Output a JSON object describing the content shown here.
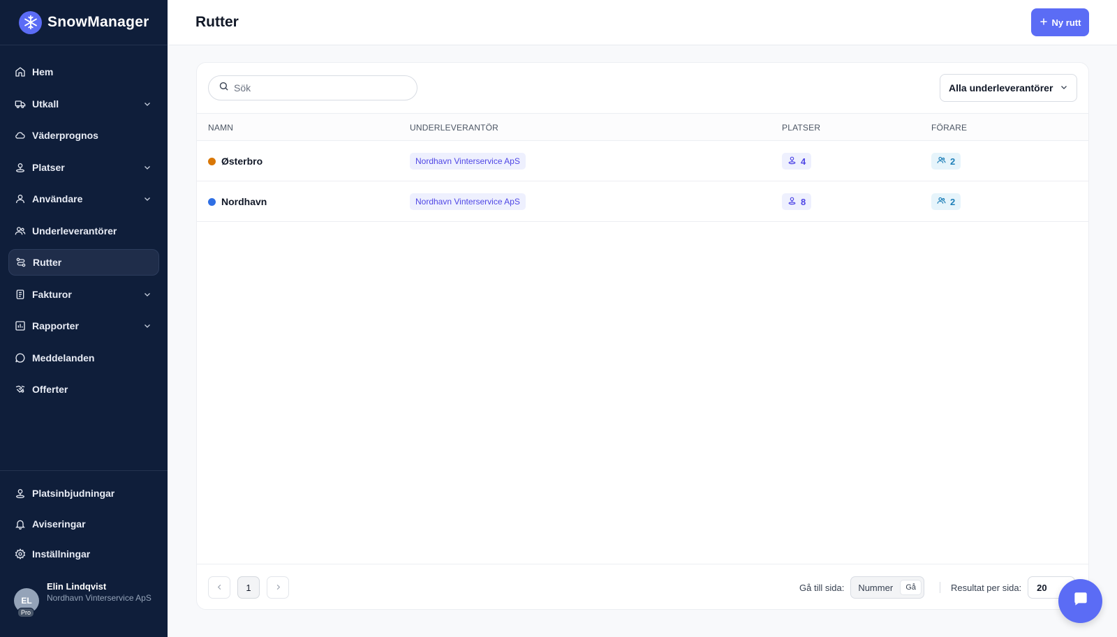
{
  "app": {
    "name": "SnowManager"
  },
  "sidebar": {
    "items": [
      {
        "label": "Hem",
        "icon": "home-icon",
        "expandable": false,
        "active": false
      },
      {
        "label": "Utkall",
        "icon": "truck-icon",
        "expandable": true,
        "active": false
      },
      {
        "label": "Väderprognos",
        "icon": "cloud-icon",
        "expandable": false,
        "active": false
      },
      {
        "label": "Platser",
        "icon": "location-pin-icon",
        "expandable": true,
        "active": false
      },
      {
        "label": "Användare",
        "icon": "user-icon",
        "expandable": true,
        "active": false
      },
      {
        "label": "Underleverantörer",
        "icon": "users-icon",
        "expandable": false,
        "active": false
      },
      {
        "label": "Rutter",
        "icon": "route-icon",
        "expandable": false,
        "active": true
      },
      {
        "label": "Fakturor",
        "icon": "invoice-icon",
        "expandable": true,
        "active": false
      },
      {
        "label": "Rapporter",
        "icon": "chart-icon",
        "expandable": true,
        "active": false
      },
      {
        "label": "Meddelanden",
        "icon": "message-icon",
        "expandable": false,
        "active": false
      },
      {
        "label": "Offerter",
        "icon": "handshake-icon",
        "expandable": false,
        "active": false
      }
    ],
    "bottom_items": [
      {
        "label": "Platsinbjudningar",
        "icon": "location-invite-icon"
      },
      {
        "label": "Aviseringar",
        "icon": "bell-icon"
      },
      {
        "label": "Inställningar",
        "icon": "gear-icon"
      }
    ],
    "user": {
      "initials": "EL",
      "badge": "Pro",
      "name": "Elin Lindqvist",
      "company": "Nordhavn Vinterservice ApS"
    }
  },
  "header": {
    "title": "Rutter",
    "new_button": "Ny rutt"
  },
  "toolbar": {
    "search_placeholder": "Sök",
    "filter_label": "Alla underleverantörer"
  },
  "table": {
    "columns": [
      "NAMN",
      "UNDERLEVERANTÖR",
      "PLATSER",
      "FÖRARE"
    ],
    "rows": [
      {
        "name": "Østerbro",
        "color": "#d97706",
        "subcontractor": "Nordhavn Vinterservice ApS",
        "places": "4",
        "drivers": "2"
      },
      {
        "name": "Nordhavn",
        "color": "#2f6fe4",
        "subcontractor": "Nordhavn Vinterservice ApS",
        "places": "8",
        "drivers": "2"
      }
    ]
  },
  "pagination": {
    "current_page": "1",
    "goto_label": "Gå till sida:",
    "goto_placeholder": "Nummer",
    "goto_button": "Gå",
    "per_page_label": "Resultat per sida:",
    "per_page_value": "20"
  },
  "colors": {
    "sidebar_bg": "#0f1e3a",
    "accent": "#5b6cf5"
  }
}
